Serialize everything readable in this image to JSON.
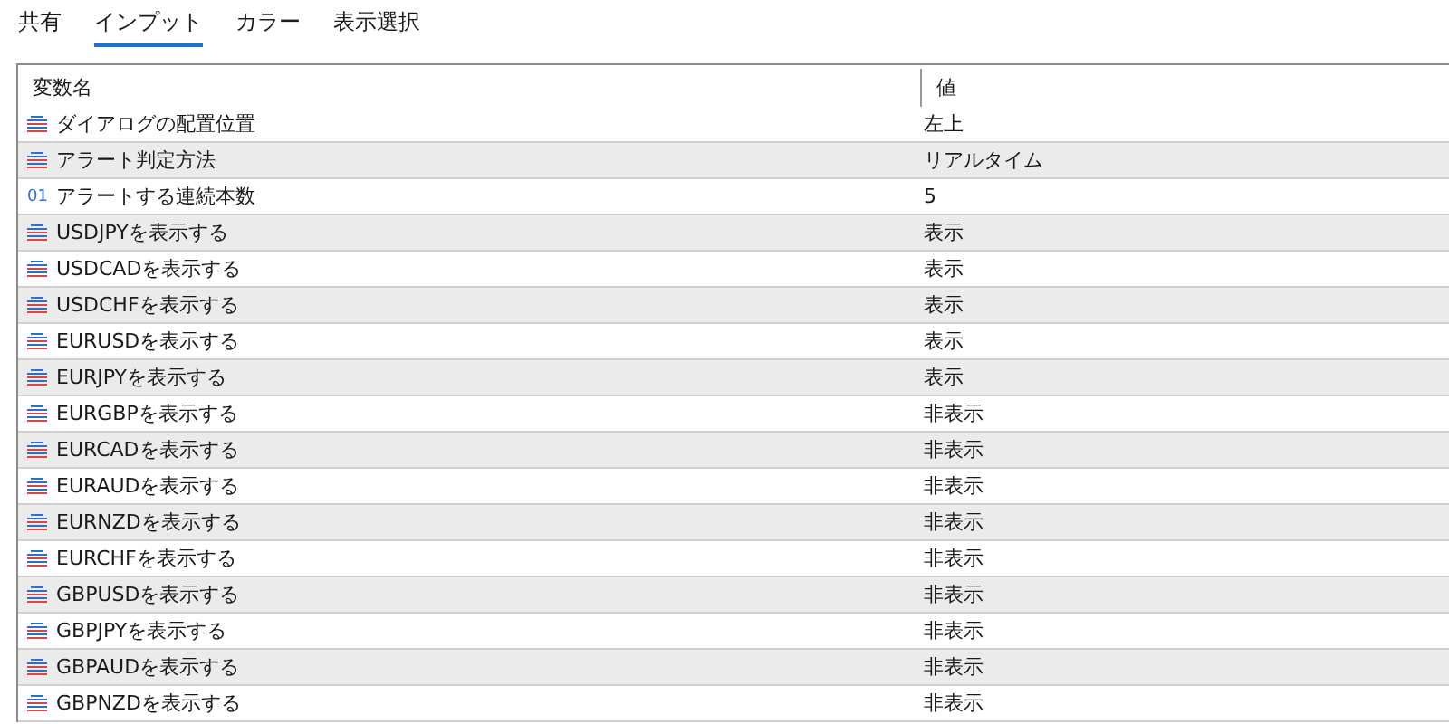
{
  "tabs": [
    {
      "label": "共有",
      "selected": false
    },
    {
      "label": "インプット",
      "selected": true
    },
    {
      "label": "カラー",
      "selected": false
    },
    {
      "label": "表示選択",
      "selected": false
    }
  ],
  "table": {
    "columns": [
      "変数名",
      "値"
    ],
    "rows": [
      {
        "kind": "enum",
        "name": "ダイアログの配置位置",
        "value": "左上"
      },
      {
        "kind": "enum",
        "name": "アラート判定方法",
        "value": "リアルタイム"
      },
      {
        "kind": "number",
        "icon_text": "01",
        "name": "アラートする連続本数",
        "value": "5"
      },
      {
        "kind": "enum",
        "name": "USDJPYを表示する",
        "value": "表示"
      },
      {
        "kind": "enum",
        "name": "USDCADを表示する",
        "value": "表示"
      },
      {
        "kind": "enum",
        "name": "USDCHFを表示する",
        "value": "表示"
      },
      {
        "kind": "enum",
        "name": "EURUSDを表示する",
        "value": "表示"
      },
      {
        "kind": "enum",
        "name": "EURJPYを表示する",
        "value": "表示"
      },
      {
        "kind": "enum",
        "name": "EURGBPを表示する",
        "value": "非表示"
      },
      {
        "kind": "enum",
        "name": "EURCADを表示する",
        "value": "非表示"
      },
      {
        "kind": "enum",
        "name": "EURAUDを表示する",
        "value": "非表示"
      },
      {
        "kind": "enum",
        "name": "EURNZDを表示する",
        "value": "非表示"
      },
      {
        "kind": "enum",
        "name": "EURCHFを表示する",
        "value": "非表示"
      },
      {
        "kind": "enum",
        "name": "GBPUSDを表示する",
        "value": "非表示"
      },
      {
        "kind": "enum",
        "name": "GBPJPYを表示する",
        "value": "非表示"
      },
      {
        "kind": "enum",
        "name": "GBPAUDを表示する",
        "value": "非表示"
      },
      {
        "kind": "enum",
        "name": "GBPNZDを表示する",
        "value": "非表示"
      }
    ]
  }
}
